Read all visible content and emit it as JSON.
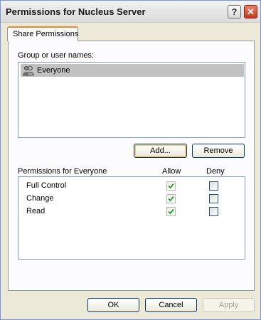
{
  "window": {
    "title": "Permissions for Nucleus Server",
    "help_glyph": "?",
    "close_glyph": "✕"
  },
  "tabs": [
    {
      "label": "Share Permissions",
      "selected": true
    }
  ],
  "users": {
    "label": "Group or user names:",
    "items": [
      {
        "name": "Everyone",
        "icon": "group-icon",
        "selected": true
      }
    ]
  },
  "buttons": {
    "add": "Add...",
    "remove": "Remove",
    "ok": "OK",
    "cancel": "Cancel",
    "apply": "Apply"
  },
  "permissions": {
    "header": "Permissions for Everyone",
    "allow_header": "Allow",
    "deny_header": "Deny",
    "rows": [
      {
        "name": "Full Control",
        "allow": true,
        "deny": false
      },
      {
        "name": "Change",
        "allow": true,
        "deny": false
      },
      {
        "name": "Read",
        "allow": true,
        "deny": false
      }
    ]
  },
  "colors": {
    "dialog_background": "#ece9d8",
    "tab_accent": "#e68b2c",
    "selection": "#c1c1c1",
    "check_mark": "#21a121"
  }
}
